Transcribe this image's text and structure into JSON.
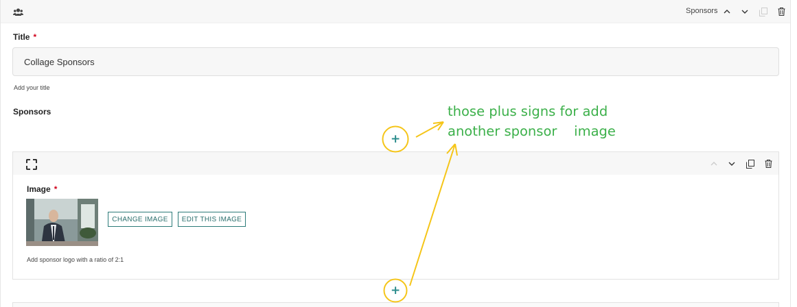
{
  "header": {
    "block_label": "Sponsors",
    "icon": "users-icon"
  },
  "title_field": {
    "label": "Title",
    "required_mark": "*",
    "value": "Collage Sponsors",
    "help": "Add your title"
  },
  "sponsors_field": {
    "label": "Sponsors"
  },
  "add_button": {
    "symbol": "+"
  },
  "sponsor_item": {
    "image_label": "Image",
    "required_mark": "*",
    "change_label": "CHANGE IMAGE",
    "edit_label": "EDIT THIS IMAGE",
    "help": "Add sponsor logo with a ratio of 2:1"
  },
  "annotation": {
    "line1": "those plus signs for add",
    "line2": "another sponsor    image"
  },
  "colors": {
    "accent": "#2b8c8c",
    "annotation_text": "#3cb04a",
    "annotation_marker": "#f5c518"
  }
}
